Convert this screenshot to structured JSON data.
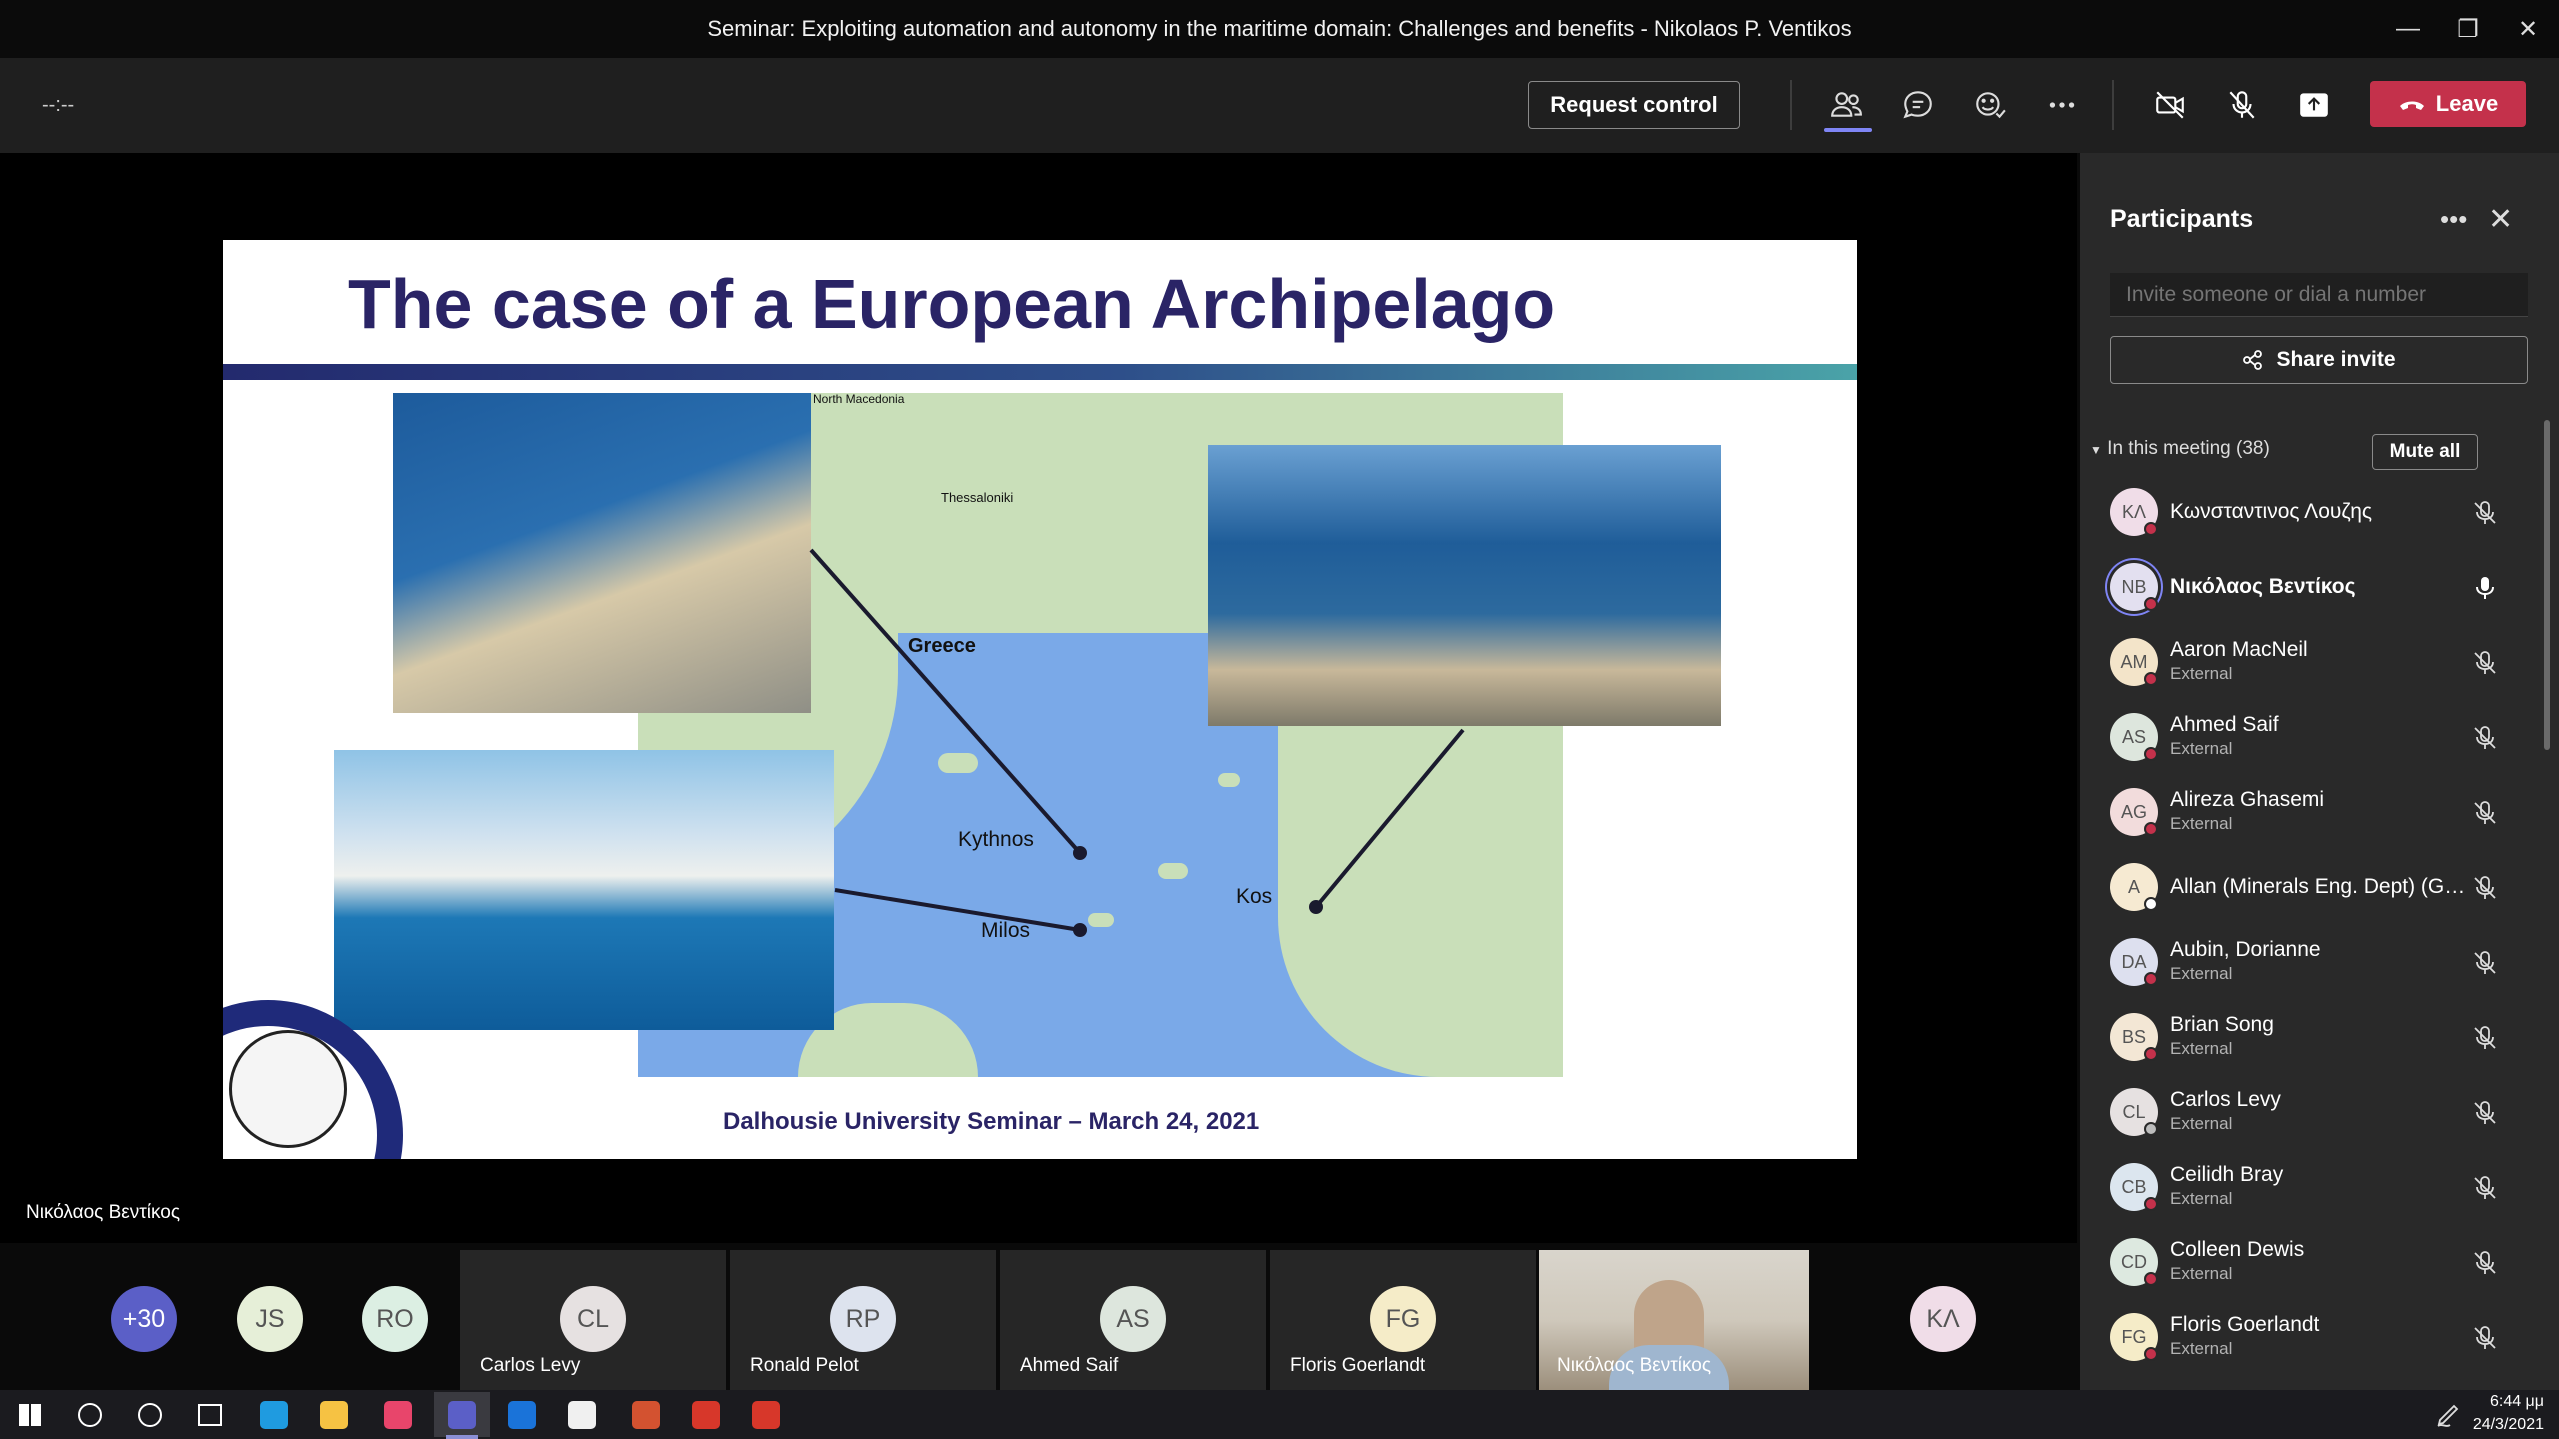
{
  "window": {
    "title": "Seminar: Exploiting automation and autonomy in the maritime domain: Challenges and benefits - Nikolaos P. Ventikos",
    "minimize": "—",
    "restore": "❐",
    "close": "✕"
  },
  "toolbar": {
    "timer": "--:--",
    "request_control": "Request control",
    "leave": "Leave",
    "icons": [
      "people-icon",
      "chat-icon",
      "reactions-icon",
      "more-icon",
      "camera-off-icon",
      "mic-off-icon",
      "share-icon"
    ]
  },
  "slide": {
    "title": "The case of a European Archipelago",
    "labels": {
      "north_macedonia": "North Macedonia",
      "thessaloniki": "Thessaloniki",
      "greece": "Greece",
      "kythnos": "Kythnos",
      "milos": "Milos",
      "kos": "Kos"
    },
    "footer": "Dalhousie University Seminar – March 24, 2021"
  },
  "stage": {
    "presenter": "Νικόλαος Βεντίκος"
  },
  "panel": {
    "title": "Participants",
    "invite_placeholder": "Invite someone or dial a number",
    "share_invite": "Share invite",
    "section": "In this meeting (38)",
    "mute_all": "Mute all",
    "participants": [
      {
        "initials": "ΚΛ",
        "name": "Κωνσταντινος Λουζης",
        "sub": "",
        "bg": "#f0dde8",
        "status": "#c4314b",
        "mic": "off",
        "bold": false
      },
      {
        "initials": "NB",
        "name": "Νικόλαος Βεντίκος",
        "sub": "",
        "bg": "#e3e0f0",
        "status": "#c4314b",
        "mic": "on",
        "bold": true
      },
      {
        "initials": "AM",
        "name": "Aaron MacNeil",
        "sub": "External",
        "bg": "#f3e4c9",
        "status": "#c4314b",
        "mic": "off",
        "bold": false
      },
      {
        "initials": "AS",
        "name": "Ahmed Saif",
        "sub": "External",
        "bg": "#dde6dd",
        "status": "#c4314b",
        "mic": "off",
        "bold": false
      },
      {
        "initials": "AG",
        "name": "Alireza Ghasemi",
        "sub": "External",
        "bg": "#f2dcdc",
        "status": "#c4314b",
        "mic": "off",
        "bold": false
      },
      {
        "initials": "A",
        "name": "Allan (Minerals Eng. Dept) (Guest)",
        "sub": "",
        "bg": "#f6ead2",
        "status": "#ffffff",
        "mic": "off",
        "bold": false
      },
      {
        "initials": "DA",
        "name": "Aubin, Dorianne",
        "sub": "External",
        "bg": "#dde0ef",
        "status": "#c4314b",
        "mic": "off",
        "bold": false
      },
      {
        "initials": "BS",
        "name": "Brian Song",
        "sub": "External",
        "bg": "#f3e7d5",
        "status": "#c4314b",
        "mic": "off",
        "bold": false
      },
      {
        "initials": "CL",
        "name": "Carlos Levy",
        "sub": "External",
        "bg": "#e6e1e1",
        "status": "#bdbdbd",
        "mic": "off",
        "bold": false
      },
      {
        "initials": "CB",
        "name": "Ceilidh Bray",
        "sub": "External",
        "bg": "#dce6ef",
        "status": "#c4314b",
        "mic": "off",
        "bold": false
      },
      {
        "initials": "CD",
        "name": "Colleen Dewis",
        "sub": "External",
        "bg": "#dde9e0",
        "status": "#c4314b",
        "mic": "off",
        "bold": false
      },
      {
        "initials": "FG",
        "name": "Floris Goerlandt",
        "sub": "External",
        "bg": "#f5ecc8",
        "status": "#c4314b",
        "mic": "off",
        "bold": false
      }
    ]
  },
  "gallery": {
    "overflow": "+30",
    "overflow_bg": "#5b5fc7",
    "avatars": [
      {
        "initials": "JS",
        "bg": "#e6efd8"
      },
      {
        "initials": "RO",
        "bg": "#dcefe3"
      }
    ],
    "tiles": [
      {
        "initials": "CL",
        "name": "Carlos Levy",
        "bg": "#e6e1e1"
      },
      {
        "initials": "RP",
        "name": "Ronald Pelot",
        "bg": "#dde3ee"
      },
      {
        "initials": "AS",
        "name": "Ahmed Saif",
        "bg": "#dde6dd"
      },
      {
        "initials": "FG",
        "name": "Floris Goerlandt",
        "bg": "#f5ecc8"
      }
    ],
    "video_name": "Νικόλαος Βεντίκος",
    "last": {
      "initials": "ΚΛ",
      "bg": "#f0dde8"
    }
  },
  "taskbar": {
    "time": "6:44 μμ",
    "date": "24/3/2021",
    "apps": [
      "start-icon",
      "search-icon",
      "cortana-icon",
      "task-view-icon",
      "edge-icon",
      "file-explorer-icon",
      "slack-icon",
      "teams-icon",
      "outlook-icon",
      "typora-icon",
      "powerpoint-icon",
      "acrobat-icon",
      "app-icon"
    ]
  },
  "colors": {
    "accent": "#7f85f5",
    "leave": "#c4314b",
    "slide_title": "#2a2466"
  }
}
